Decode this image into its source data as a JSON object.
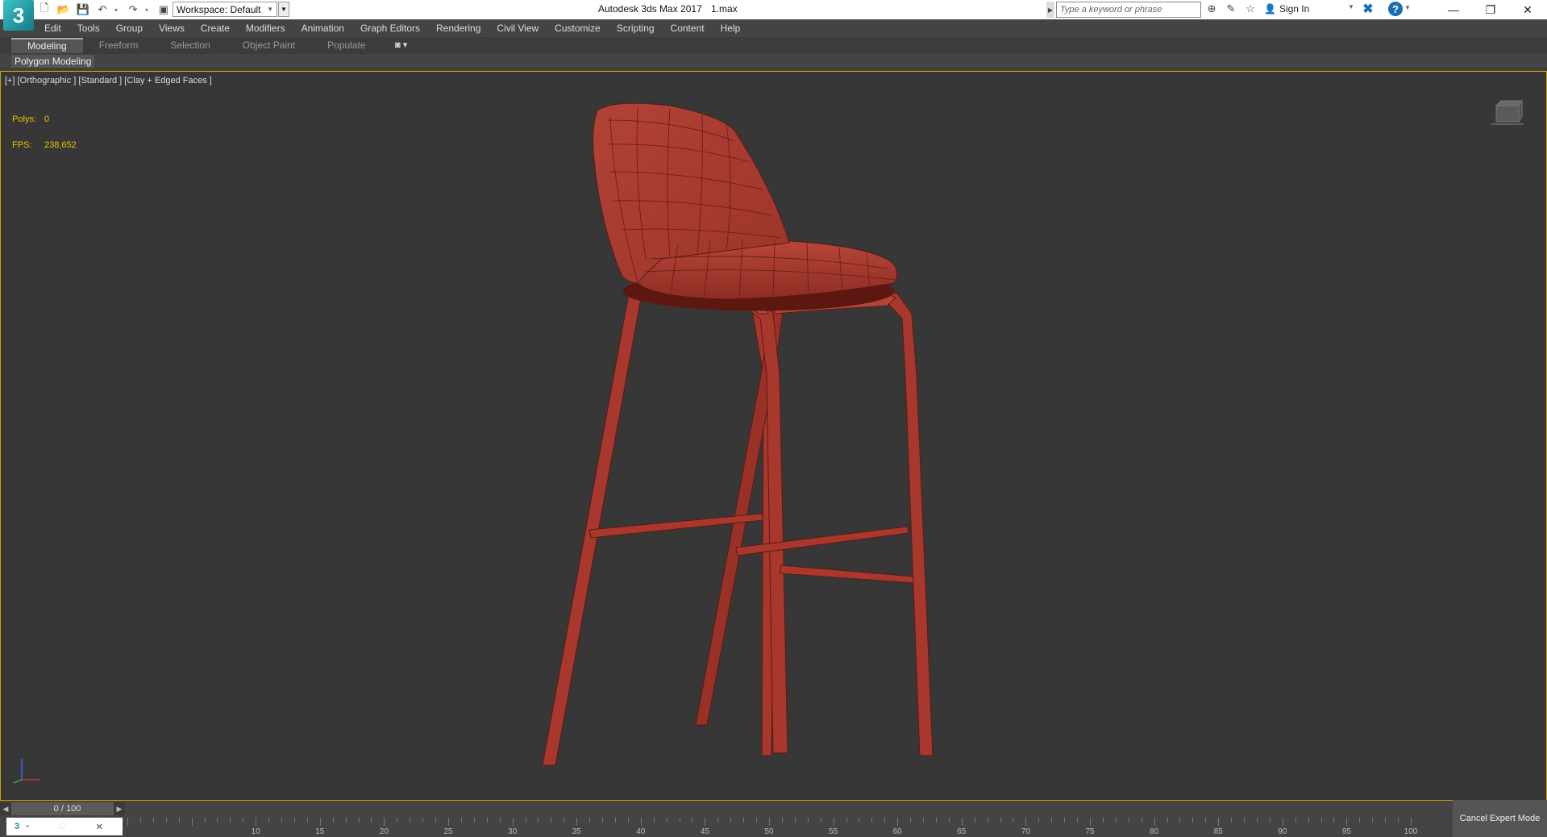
{
  "titlebar": {
    "logo_text": "3",
    "workspace_label": "Workspace: Default",
    "title": "Autodesk 3ds Max 2017",
    "file": "1.max",
    "search_placeholder": "Type a keyword or phrase",
    "sign_in": "Sign In",
    "icons": [
      "new-file-icon",
      "open-file-icon",
      "save-icon",
      "undo-icon",
      "redo-icon",
      "project-folder-icon"
    ]
  },
  "menu": [
    "Edit",
    "Tools",
    "Group",
    "Views",
    "Create",
    "Modifiers",
    "Animation",
    "Graph Editors",
    "Rendering",
    "Civil View",
    "Customize",
    "Scripting",
    "Content",
    "Help"
  ],
  "ribbon": {
    "tabs": [
      "Modeling",
      "Freeform",
      "Selection",
      "Object Paint",
      "Populate"
    ],
    "active_tab": "Modeling",
    "panel_label": "Polygon Modeling"
  },
  "viewport": {
    "label": "[+] [Orthographic ] [Standard ] [Clay + Edged Faces ]",
    "polys_label": "Polys:",
    "polys_value": "0",
    "fps_label": "FPS:",
    "fps_value": "238,652",
    "border_color": "#c9a400",
    "model_color": "#a8382d"
  },
  "timeline": {
    "frame_display": "0 / 100",
    "ticks": [
      10,
      15,
      20,
      25,
      30,
      35,
      40,
      45,
      50,
      55,
      60,
      65,
      70,
      75,
      80,
      85,
      90,
      95,
      100
    ]
  },
  "status": {
    "cancel_expert_mode": "Cancel Expert Mode"
  }
}
